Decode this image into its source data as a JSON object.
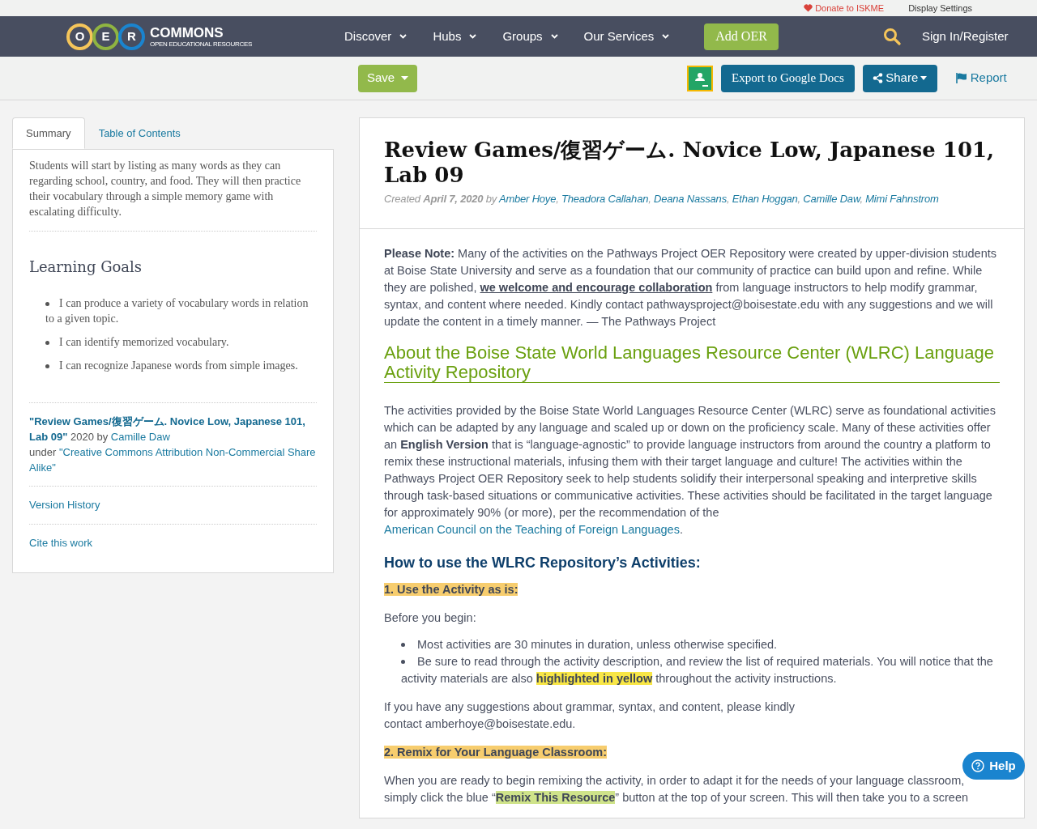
{
  "top_bar": {
    "donate": "Donate to ISKME",
    "display_settings": "Display Settings"
  },
  "nav": {
    "logo": {
      "letters": [
        "O",
        "E",
        "R"
      ],
      "name": "COMMONS",
      "tagline": "OPEN EDUCATIONAL RESOURCES"
    },
    "menu": [
      {
        "label": "Discover",
        "dropdown": true
      },
      {
        "label": "Hubs",
        "dropdown": true
      },
      {
        "label": "Groups",
        "dropdown": true
      },
      {
        "label": "Our Services",
        "dropdown": true
      }
    ],
    "add_button": "Add OER",
    "sign_in": "Sign In/Register"
  },
  "toolbar": {
    "save": "Save",
    "export": "Export to Google Docs",
    "share": "Share",
    "report": "Report"
  },
  "sidebar": {
    "tabs": [
      {
        "label": "Summary",
        "selected": true
      },
      {
        "label": "Table of Contents",
        "selected": false
      }
    ],
    "summary": "Students will start by listing as many words as they can regarding school, country, and food. They will then practice their vocabulary through a simple memory game with escalating difficulty.",
    "goals_heading": "Learning Goals",
    "goals": [
      "I can produce a variety of vocabulary words in relation to a given topic.",
      "I can identify memorized vocabulary.",
      "I can recognize Japanese words from simple images."
    ],
    "citation": {
      "title": "\"Review Games/復習ゲーム. Novice Low, Japanese 101, Lab 09\"",
      "year_by": "2020 by",
      "author": "Camille Daw",
      "under": "under",
      "license": "\"Creative Commons Attribution Non-Commercial Share Alike\""
    },
    "links": [
      "Version History",
      "Cite this work"
    ]
  },
  "main": {
    "title": "Review Games/復習ゲーム. Novice Low, Japanese 101, Lab 09",
    "created": {
      "label": "Created",
      "date": "April 7, 2020",
      "by": "by",
      "separator": ",",
      "authors": [
        "Amber Hoye",
        "Theadora Callahan",
        "Deana Nassans",
        "Ethan Hoggan",
        "Camille Daw",
        "Mimi Fahnstrom"
      ]
    },
    "blocks": [
      {
        "kind": "paragraph",
        "segments": [
          {
            "kind": "bold",
            "text": "Please Note:"
          },
          {
            "kind": "text",
            "text": " Many of the activities on the Pathways Project OER Repository were created by upper-division students at Boise State University and serve as a foundation that our community of practice can build upon and refine. While they are polished, "
          },
          {
            "kind": "strong_link",
            "text": "we welcome and encourage collaboration"
          },
          {
            "kind": "text",
            "text": " from language instructors to help modify grammar, syntax, and content where needed. Kindly contact pathwaysproject@boisestate.edu with any suggestions and we will update the content in a timely manner.  — The Pathways Project"
          }
        ]
      },
      {
        "kind": "green_heading",
        "text": "About the Boise State World Languages Resource Center (WLRC) Language Activity Repository"
      },
      {
        "kind": "paragraph",
        "segments": [
          {
            "kind": "text",
            "text": "The activities provided by the Boise State World Languages Resource Center (WLRC) serve as foundational activities which can be adapted by any language and scaled up or down on the proficiency scale. Many of these activities offer an "
          },
          {
            "kind": "bold",
            "text": "English Version"
          },
          {
            "kind": "text",
            "text": " that is “language-agnostic” to provide language instructors from around the country a platform to remix these instructional materials, infusing them with their target language and culture! The activities within the Pathways Project OER Repository seek to help students solidify their interpersonal speaking and interpretive skills through task-based situations or communicative activities. These activities should be facilitated in the target language for approximately 90% (or more), per the recommendation of the "
          },
          {
            "kind": "link",
            "text": "American Council on the Teaching of Foreign Languages"
          },
          {
            "kind": "text",
            "text": "."
          }
        ]
      },
      {
        "kind": "blue_heading",
        "text": "How to use the WLRC Repository’s Activities:"
      },
      {
        "kind": "step_heading",
        "text": "1. Use the Activity as is:"
      },
      {
        "kind": "paragraph",
        "segments": [
          {
            "kind": "text",
            "text": "Before you begin:"
          }
        ]
      },
      {
        "kind": "bullets",
        "items": [
          [
            {
              "kind": "text",
              "text": "Most activities are 30 minutes in duration, unless otherwise specified."
            }
          ],
          [
            {
              "kind": "text",
              "text": "Be sure to read through the activity description, and review the list of required materials. You will notice that the activity materials are also "
            },
            {
              "kind": "yellow_mark",
              "text": "highlighted in yellow"
            },
            {
              "kind": "text",
              "text": " throughout the activity instructions."
            }
          ]
        ]
      },
      {
        "kind": "short_paragraph",
        "segments": [
          {
            "kind": "text",
            "text": "If you have any suggestions about grammar, syntax, and content, please kindly contact amberhoye@boisestate.edu."
          }
        ]
      },
      {
        "kind": "step_heading",
        "text": "2. Remix for Your Language Classroom:"
      },
      {
        "kind": "paragraph",
        "segments": [
          {
            "kind": "text",
            "text": "When you are ready to begin remixing the activity, in order to adapt it for the needs of your language classroom, simply click the blue “"
          },
          {
            "kind": "green_mark",
            "text": "Remix This Resource"
          },
          {
            "kind": "text",
            "text": "” button at the top of your screen. This will then take you to a screen"
          }
        ]
      }
    ]
  },
  "help_button": "Help"
}
